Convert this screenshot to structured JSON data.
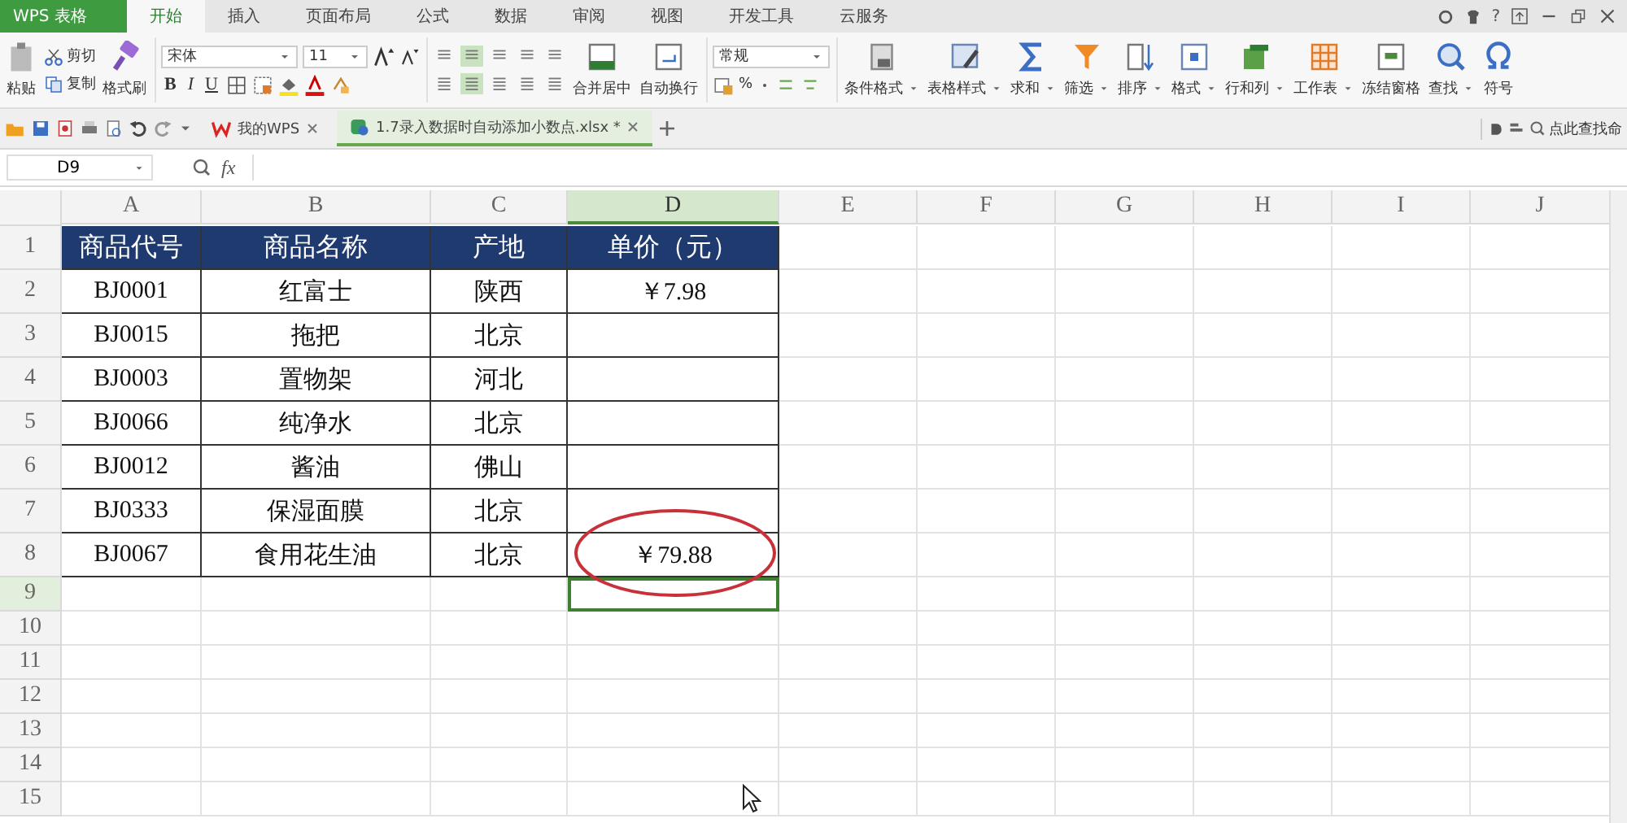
{
  "app": {
    "logo": "WPS 表格"
  },
  "menu_tabs": [
    {
      "label": "开始",
      "selected": true
    },
    {
      "label": "插入",
      "selected": false
    },
    {
      "label": "页面布局",
      "selected": false
    },
    {
      "label": "公式",
      "selected": false
    },
    {
      "label": "数据",
      "selected": false
    },
    {
      "label": "审阅",
      "selected": false
    },
    {
      "label": "视图",
      "selected": false
    },
    {
      "label": "开发工具",
      "selected": false
    },
    {
      "label": "云服务",
      "selected": false
    }
  ],
  "help_label": "?",
  "ribbon": {
    "paste": "粘贴",
    "cut": "剪切",
    "copy": "复制",
    "format_painter": "格式刷",
    "font_name": "宋体",
    "font_size": "11",
    "style_buttons": [
      "B",
      "I",
      "U"
    ],
    "alignment_rows": [
      [
        {
          "selected": false
        },
        {
          "selected": true
        },
        {
          "selected": false
        },
        {
          "selected": false
        },
        {
          "selected": false
        }
      ],
      [
        {
          "selected": false
        },
        {
          "selected": true
        },
        {
          "selected": false
        },
        {
          "selected": false
        },
        {
          "selected": false
        }
      ]
    ],
    "merge": "合并居中",
    "wrap": "自动换行",
    "number_format": "常规",
    "percent": "%",
    "big_buttons": [
      {
        "label": "条件格式",
        "dropdown": true
      },
      {
        "label": "表格样式",
        "dropdown": true
      },
      {
        "label": "求和",
        "dropdown": true
      },
      {
        "label": "筛选",
        "dropdown": true
      },
      {
        "label": "排序",
        "dropdown": true
      },
      {
        "label": "格式",
        "dropdown": true
      },
      {
        "label": "行和列",
        "dropdown": true
      },
      {
        "label": "工作表",
        "dropdown": true
      },
      {
        "label": "冻结窗格",
        "dropdown": false
      },
      {
        "label": "查找",
        "dropdown": true
      },
      {
        "label": "符号",
        "dropdown": false
      }
    ]
  },
  "doc_tabs": [
    {
      "label": "我的WPS",
      "selected": false
    },
    {
      "label": "1.7录入数据时自动添加小数点.xlsx *",
      "selected": true
    }
  ],
  "command_search": {
    "placeholder": "点此查找命"
  },
  "formula_bar": {
    "name_box": "D9",
    "fx_label": "fx"
  },
  "columns": [
    {
      "label": "A",
      "selected": false
    },
    {
      "label": "B",
      "selected": false
    },
    {
      "label": "C",
      "selected": false
    },
    {
      "label": "D",
      "selected": true
    },
    {
      "label": "E",
      "selected": false
    },
    {
      "label": "F",
      "selected": false
    },
    {
      "label": "G",
      "selected": false
    },
    {
      "label": "H",
      "selected": false
    },
    {
      "label": "I",
      "selected": false
    },
    {
      "label": "J",
      "selected": false
    }
  ],
  "rows": [
    {
      "number": "1",
      "kind": "header",
      "selected": false,
      "cells": [
        "商品代号",
        "商品名称",
        "产地",
        "单价（元）"
      ]
    },
    {
      "number": "2",
      "kind": "data",
      "selected": false,
      "cells": [
        "BJ0001",
        "红富士",
        "陕西",
        "￥7.98"
      ]
    },
    {
      "number": "3",
      "kind": "data",
      "selected": false,
      "cells": [
        "BJ0015",
        "拖把",
        "北京",
        null
      ]
    },
    {
      "number": "4",
      "kind": "data",
      "selected": false,
      "cells": [
        "BJ0003",
        "置物架",
        "河北",
        null
      ]
    },
    {
      "number": "5",
      "kind": "data",
      "selected": false,
      "cells": [
        "BJ0066",
        "纯净水",
        "北京",
        null
      ]
    },
    {
      "number": "6",
      "kind": "data",
      "selected": false,
      "cells": [
        "BJ0012",
        "酱油",
        "佛山",
        null
      ]
    },
    {
      "number": "7",
      "kind": "data",
      "selected": false,
      "cells": [
        "BJ0333",
        "保湿面膜",
        "北京",
        null
      ]
    },
    {
      "number": "8",
      "kind": "data",
      "selected": false,
      "cells": [
        "BJ0067",
        "食用花生油",
        "北京",
        "￥79.88"
      ]
    },
    {
      "number": "9",
      "kind": "empty",
      "selected": true
    },
    {
      "number": "10",
      "kind": "empty",
      "selected": false
    },
    {
      "number": "11",
      "kind": "empty",
      "selected": false
    },
    {
      "number": "12",
      "kind": "empty",
      "selected": false
    },
    {
      "number": "13",
      "kind": "empty",
      "selected": false
    },
    {
      "number": "14",
      "kind": "empty",
      "selected": false
    },
    {
      "number": "15",
      "kind": "empty",
      "selected": false
    }
  ]
}
